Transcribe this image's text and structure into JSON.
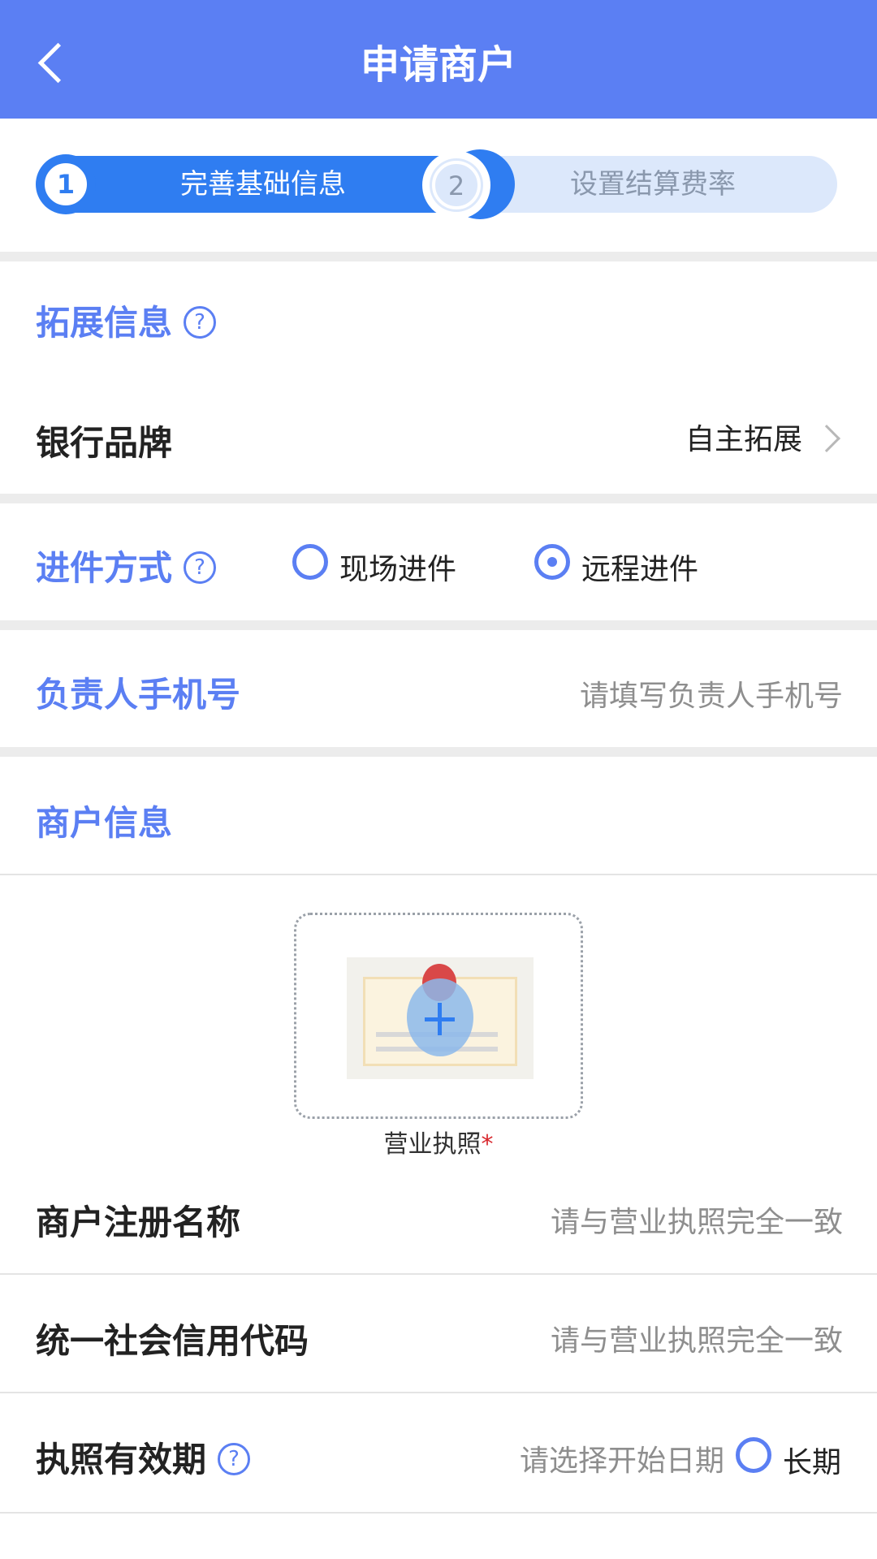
{
  "header": {
    "title": "申请商户"
  },
  "steps": [
    {
      "number": "1",
      "label": "完善基础信息"
    },
    {
      "number": "2",
      "label": "设置结算费率"
    }
  ],
  "expansion": {
    "title": "拓展信息",
    "help": "?",
    "bank_brand_label": "银行品牌",
    "bank_brand_value": "自主拓展"
  },
  "entry_method": {
    "label": "进件方式",
    "help": "?",
    "options": [
      {
        "label": "现场进件",
        "checked": false
      },
      {
        "label": "远程进件",
        "checked": true
      }
    ]
  },
  "owner_phone": {
    "label": "负责人手机号",
    "placeholder": "请填写负责人手机号"
  },
  "merchant": {
    "title": "商户信息",
    "upload_label": "营业执照",
    "required_mark": "*",
    "reg_name_label": "商户注册名称",
    "reg_name_placeholder": "请与营业执照完全一致",
    "credit_code_label": "统一社会信用代码",
    "credit_code_placeholder": "请与营业执照完全一致",
    "validity_label": "执照有效期",
    "validity_help": "?",
    "validity_placeholder": "请选择开始日期",
    "long_term_label": "长期"
  },
  "colors": {
    "primary": "#5b7ff3",
    "step_active": "#2f7df1",
    "step_inactive": "#dce8fb"
  },
  "icons": [
    "back-arrow-icon",
    "help-icon",
    "chevron-right-icon",
    "radio-icon",
    "plus-icon",
    "license-icon"
  ]
}
